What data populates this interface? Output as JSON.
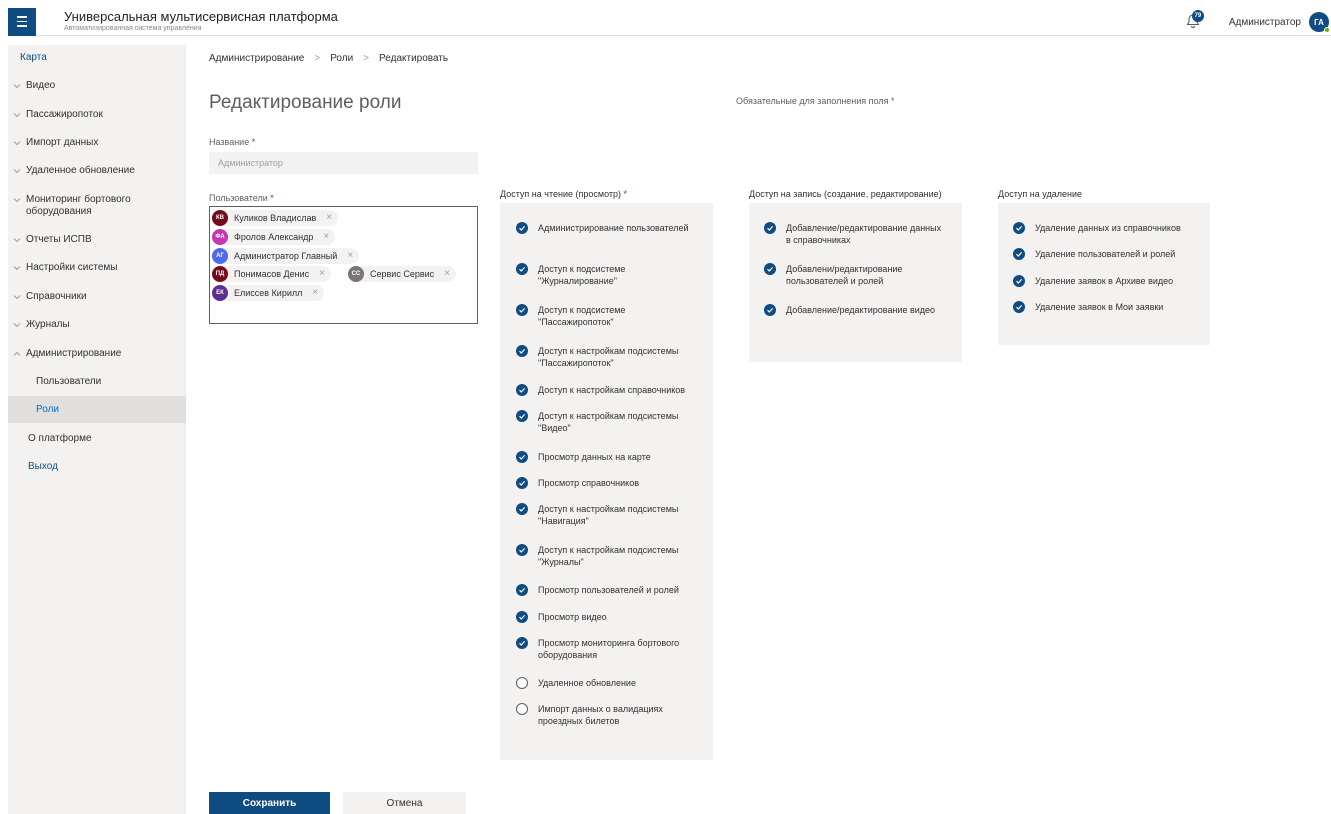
{
  "header": {
    "app_title": "Универсальная мультисервисная платформа",
    "app_subtitle": "Автоматизированная система управления",
    "notifications_count": "79",
    "user_name": "Администратор",
    "user_initials": "ГА"
  },
  "sidebar": {
    "items": [
      {
        "label": "Карта"
      },
      {
        "label": "Видео"
      },
      {
        "label": "Пассажиропоток"
      },
      {
        "label": "Импорт данных"
      },
      {
        "label": "Удаленное обновление"
      },
      {
        "label": "Мониторинг бортового оборудования"
      },
      {
        "label": "Отчеты ИСПВ"
      },
      {
        "label": "Настройки системы"
      },
      {
        "label": "Справочники"
      },
      {
        "label": "Журналы"
      },
      {
        "label": "Администрирование"
      },
      {
        "label": "Пользователи"
      },
      {
        "label": "Роли"
      },
      {
        "label": "О платформе"
      },
      {
        "label": "Выход"
      }
    ]
  },
  "breadcrumb": [
    "Администрирование",
    "Роли",
    "Редактировать"
  ],
  "page": {
    "title": "Редактирование роли",
    "required_note": "Обязательные для заполнения поля *"
  },
  "form": {
    "name_label": "Название",
    "name_placeholder": "Администратор",
    "users_label": "Пользователи",
    "required_mark": "*",
    "users": [
      {
        "initials": "КВ",
        "name": "Куликов Владислав",
        "color": "#750b1c"
      },
      {
        "initials": "ФА",
        "name": "Фролов Александр",
        "color": "#c239b3"
      },
      {
        "initials": "АГ",
        "name": "Администратор Главный",
        "color": "#4f6bed"
      },
      {
        "initials": "ПД",
        "name": "Понимасов Денис",
        "color": "#750b1c"
      },
      {
        "initials": "СС",
        "name": "Сервис Сервис",
        "color": "#7a7574"
      },
      {
        "initials": "ЕК",
        "name": "Елиссев Кирилл",
        "color": "#5c2e91"
      }
    ]
  },
  "permissions": {
    "read": {
      "title": "Доступ на чтение (просмотр)",
      "items": [
        {
          "label": "Администрирование пользователей",
          "checked": true
        },
        {
          "label": "Доступ к подсистеме \"Журналирование\"",
          "checked": true
        },
        {
          "label": "Доступ к подсистеме \"Пассажиропоток\"",
          "checked": true
        },
        {
          "label": "Доступ к настройкам подсистемы \"Пассажиропоток\"",
          "checked": true
        },
        {
          "label": "Доступ к настройкам справочников",
          "checked": true
        },
        {
          "label": "Доступ к настройкам подсистемы \"Видео\"",
          "checked": true
        },
        {
          "label": "Просмотр данных на карте",
          "checked": true
        },
        {
          "label": "Просмотр справочников",
          "checked": true
        },
        {
          "label": "Доступ к настройкам подсистемы \"Навигация\"",
          "checked": true
        },
        {
          "label": "Доступ к настройкам подсистемы \"Журналы\"",
          "checked": true
        },
        {
          "label": "Просмотр пользователей и ролей",
          "checked": true
        },
        {
          "label": "Просмотр видео",
          "checked": true
        },
        {
          "label": "Просмотр мониторинга бортового оборудования",
          "checked": true
        },
        {
          "label": "Удаленное обновление",
          "checked": false
        },
        {
          "label": "Импорт данных о валидациях проездных билетов",
          "checked": false
        }
      ]
    },
    "write": {
      "title": "Доступ на запись (создание, редактирование)",
      "items": [
        {
          "label": "Добавление/редактирование данных в справочниках",
          "checked": true
        },
        {
          "label": "Добавлени/редактирование пользователей и ролей",
          "checked": true
        },
        {
          "label": "Добавление/редактирование видео",
          "checked": true
        }
      ]
    },
    "delete": {
      "title": "Доступ на удаление",
      "items": [
        {
          "label": "Удаление данных из справочников",
          "checked": true
        },
        {
          "label": "Удаление пользователей и ролей",
          "checked": true
        },
        {
          "label": "Удаление заявок в Архиве видео",
          "checked": true
        },
        {
          "label": "Удаление заявок в Мои заявки",
          "checked": true
        }
      ]
    }
  },
  "actions": {
    "save_label": "Сохранить",
    "cancel_label": "Отмена"
  }
}
